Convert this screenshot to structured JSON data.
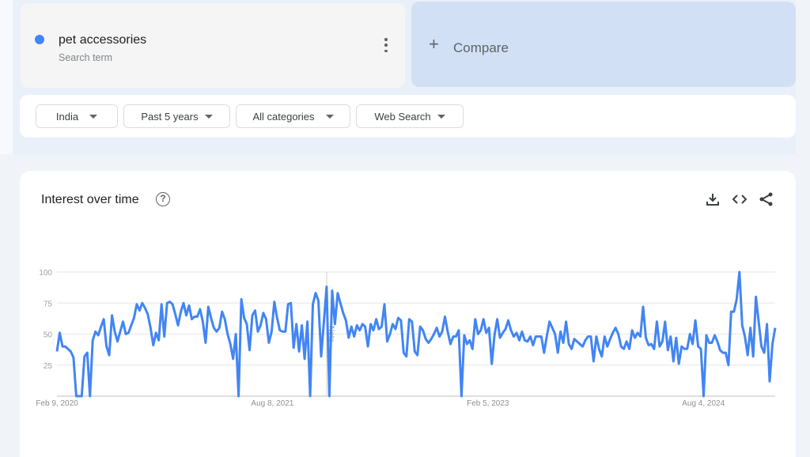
{
  "search_term": {
    "name": "pet accessories",
    "subtitle": "Search term",
    "color": "#4285f4",
    "menu_icon": "more-vert-icon"
  },
  "compare": {
    "label": "Compare",
    "icon": "plus-icon"
  },
  "filters": [
    {
      "label": "India"
    },
    {
      "label": "Past 5 years"
    },
    {
      "label": "All categories"
    },
    {
      "label": "Web Search"
    }
  ],
  "card": {
    "title": "Interest over time",
    "icons": [
      "help-icon",
      "download-icon",
      "embed-code-icon",
      "share-icon"
    ]
  },
  "chart_data": {
    "type": "line",
    "title": "",
    "y_ticks": [
      "25",
      "50",
      "75",
      "100"
    ],
    "ylim": [
      0,
      100
    ],
    "x_ticks": [
      "Feb 9, 2020",
      "Aug 8, 2021",
      "Feb 5, 2023",
      "Aug 4, 2024"
    ],
    "x_range": [
      "Feb 9, 2020",
      "Feb 2, 2025"
    ],
    "annotation": "Note",
    "grid": true,
    "color": "#4285f4",
    "values": [
      36,
      51,
      40,
      40,
      38,
      36,
      31,
      0,
      0,
      0,
      32,
      35,
      0,
      45,
      52,
      49,
      56,
      62,
      40,
      33,
      65,
      52,
      44,
      52,
      60,
      50,
      51,
      57,
      63,
      74,
      69,
      75,
      71,
      66,
      55,
      41,
      51,
      45,
      74,
      48,
      75,
      76,
      74,
      66,
      57,
      68,
      75,
      65,
      73,
      62,
      64,
      64,
      70,
      60,
      43,
      72,
      63,
      55,
      52,
      55,
      68,
      62,
      50,
      42,
      30,
      50,
      0,
      78,
      63,
      58,
      37,
      65,
      69,
      52,
      57,
      67,
      62,
      43,
      52,
      76,
      63,
      53,
      52,
      52,
      74,
      75,
      39,
      58,
      36,
      57,
      30,
      60,
      0,
      74,
      83,
      77,
      32,
      60,
      88,
      0,
      85,
      58,
      83,
      75,
      67,
      61,
      47,
      56,
      48,
      57,
      53,
      58,
      56,
      40,
      58,
      53,
      62,
      54,
      56,
      74,
      44,
      50,
      58,
      54,
      63,
      61,
      35,
      32,
      62,
      60,
      36,
      33,
      56,
      53,
      46,
      43,
      46,
      50,
      55,
      48,
      52,
      64,
      52,
      42,
      48,
      48,
      53,
      0,
      49,
      42,
      45,
      38,
      62,
      50,
      53,
      62,
      51,
      55,
      26,
      49,
      62,
      47,
      51,
      54,
      61,
      53,
      48,
      51,
      45,
      52,
      45,
      44,
      48,
      41,
      48,
      48,
      48,
      35,
      48,
      60,
      55,
      50,
      35,
      52,
      43,
      60,
      42,
      38,
      46,
      44,
      42,
      40,
      45,
      48,
      48,
      28,
      48,
      38,
      32,
      48,
      40,
      46,
      51,
      55,
      50,
      40,
      38,
      44,
      38,
      53,
      47,
      51,
      48,
      72,
      47,
      41,
      42,
      38,
      60,
      40,
      44,
      60,
      37,
      48,
      28,
      47,
      26,
      40,
      38,
      38,
      50,
      42,
      61,
      40,
      38,
      0,
      49,
      43,
      43,
      49,
      44,
      37,
      35,
      35,
      25,
      68,
      68,
      78,
      100,
      57,
      48,
      33,
      55,
      32,
      80,
      60,
      40,
      35,
      58,
      12,
      42,
      55
    ]
  }
}
